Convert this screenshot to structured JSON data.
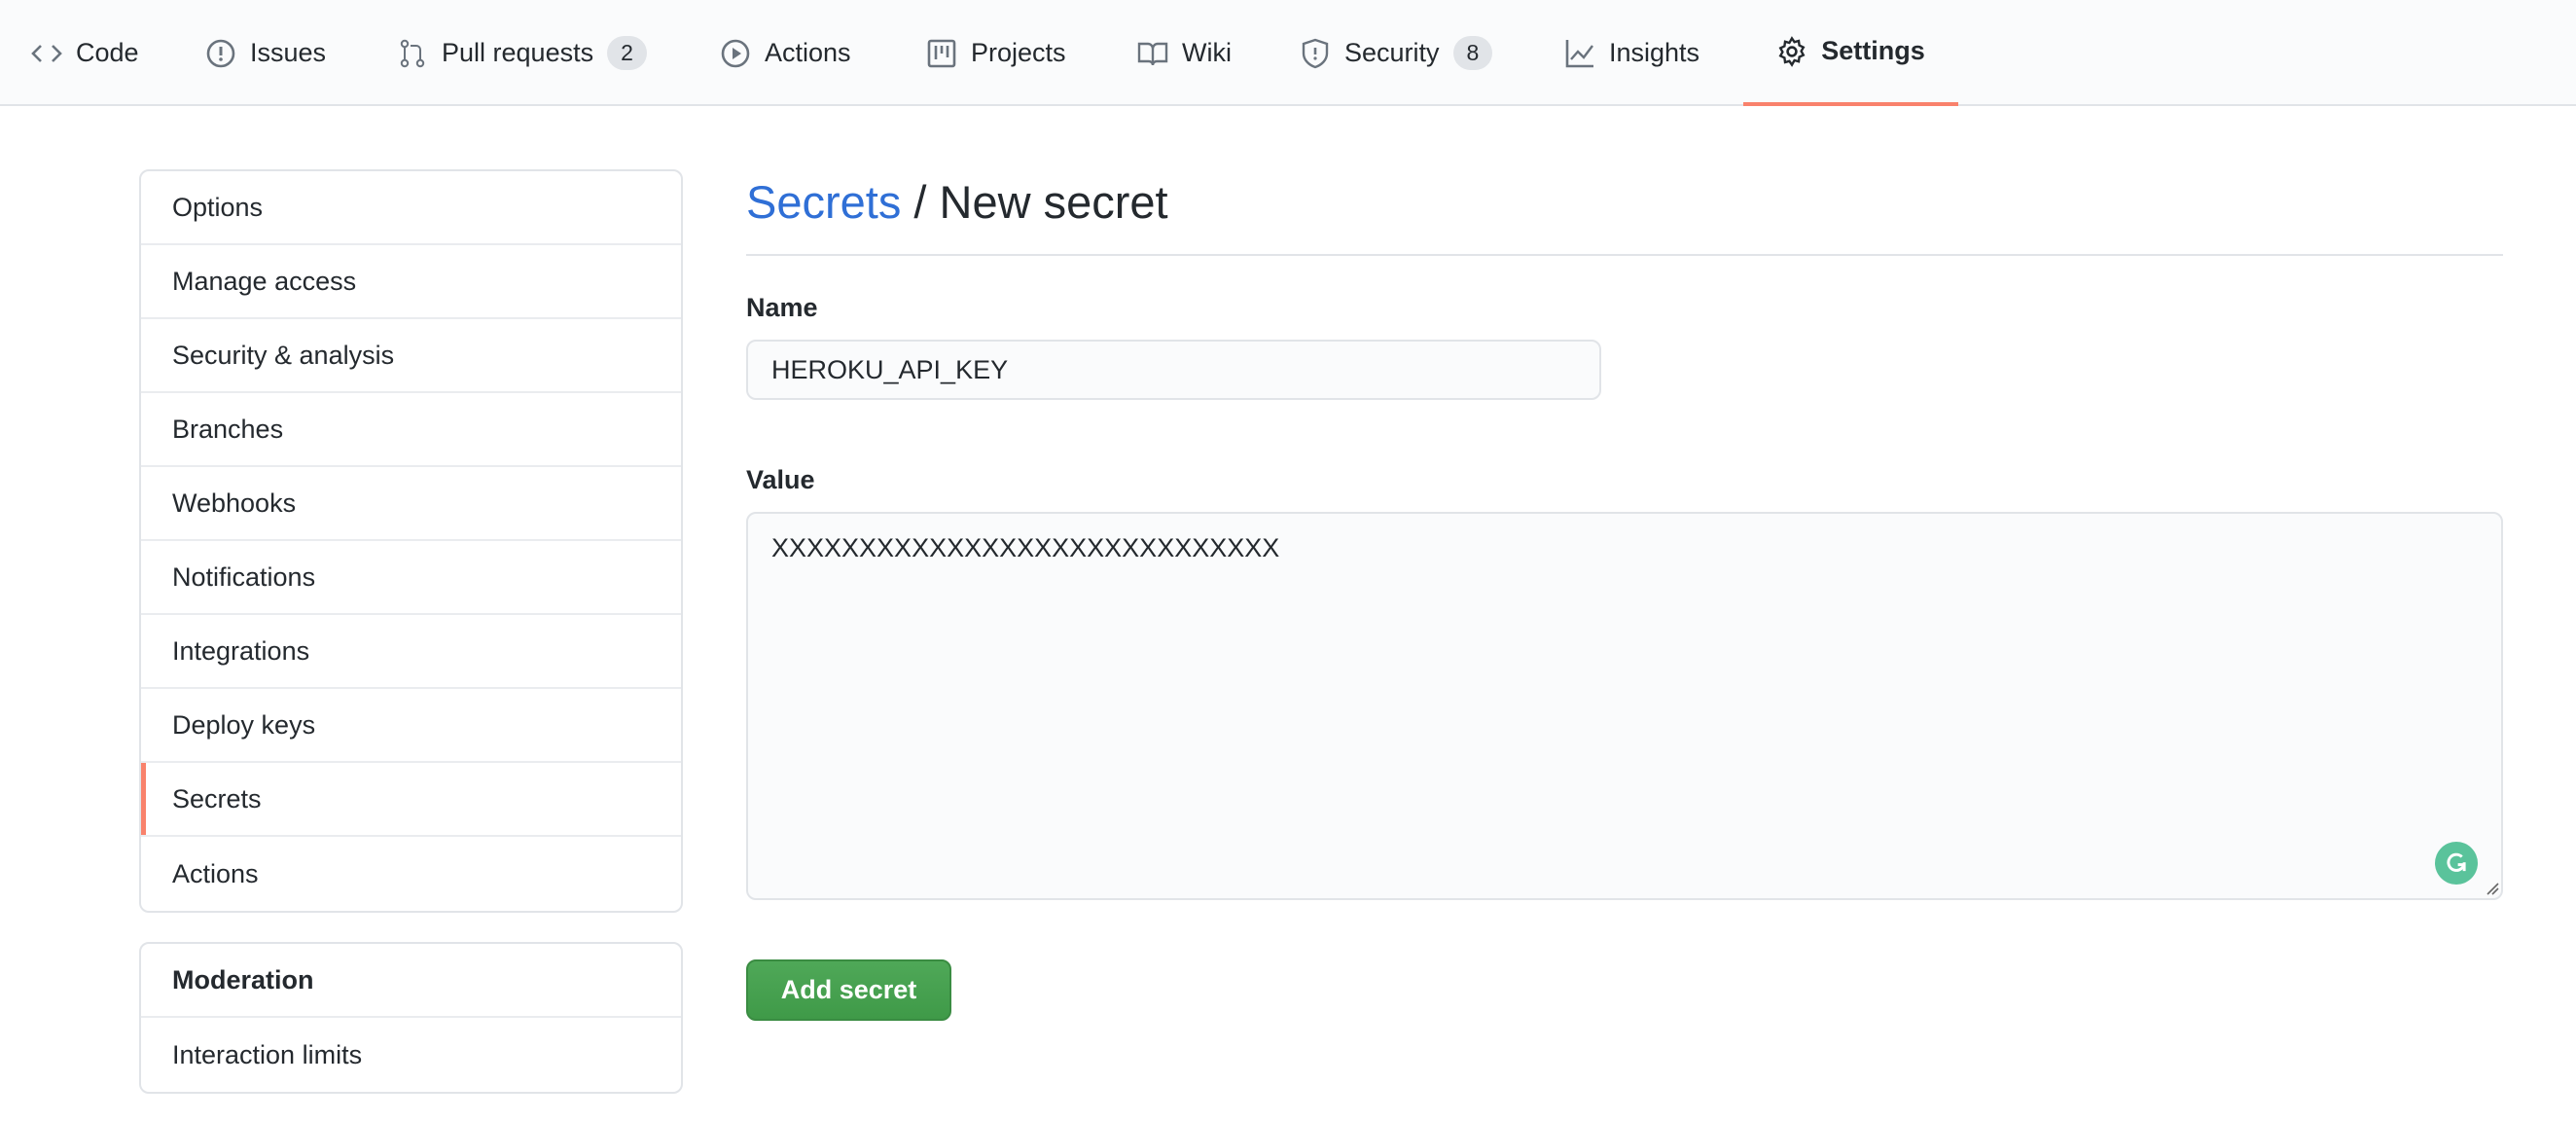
{
  "nav": {
    "tabs": [
      {
        "label": "Code",
        "icon": "code-icon"
      },
      {
        "label": "Issues",
        "icon": "issue-icon"
      },
      {
        "label": "Pull requests",
        "icon": "pull-request-icon",
        "count": "2"
      },
      {
        "label": "Actions",
        "icon": "play-icon"
      },
      {
        "label": "Projects",
        "icon": "project-icon"
      },
      {
        "label": "Wiki",
        "icon": "book-icon"
      },
      {
        "label": "Security",
        "icon": "shield-icon",
        "count": "8"
      },
      {
        "label": "Insights",
        "icon": "graph-icon"
      },
      {
        "label": "Settings",
        "icon": "gear-icon",
        "selected": true
      }
    ],
    "accent": "#f9826c"
  },
  "sidebar": {
    "items": [
      "Options",
      "Manage access",
      "Security & analysis",
      "Branches",
      "Webhooks",
      "Notifications",
      "Integrations",
      "Deploy keys",
      "Secrets",
      "Actions"
    ],
    "selected": "Secrets",
    "moderation": {
      "heading": "Moderation",
      "items": [
        "Interaction limits"
      ]
    }
  },
  "main": {
    "breadcrumb_link": "Secrets",
    "breadcrumb_sep": " / ",
    "title": "New secret",
    "name_label": "Name",
    "name_value": "HEROKU_API_KEY",
    "value_label": "Value",
    "value_value": "XXXXXXXXXXXXXXXXXXXXXXXXXXXXX",
    "submit_label": "Add secret",
    "submit_color": "#3fa14c",
    "link_color": "#2f6fd6"
  }
}
